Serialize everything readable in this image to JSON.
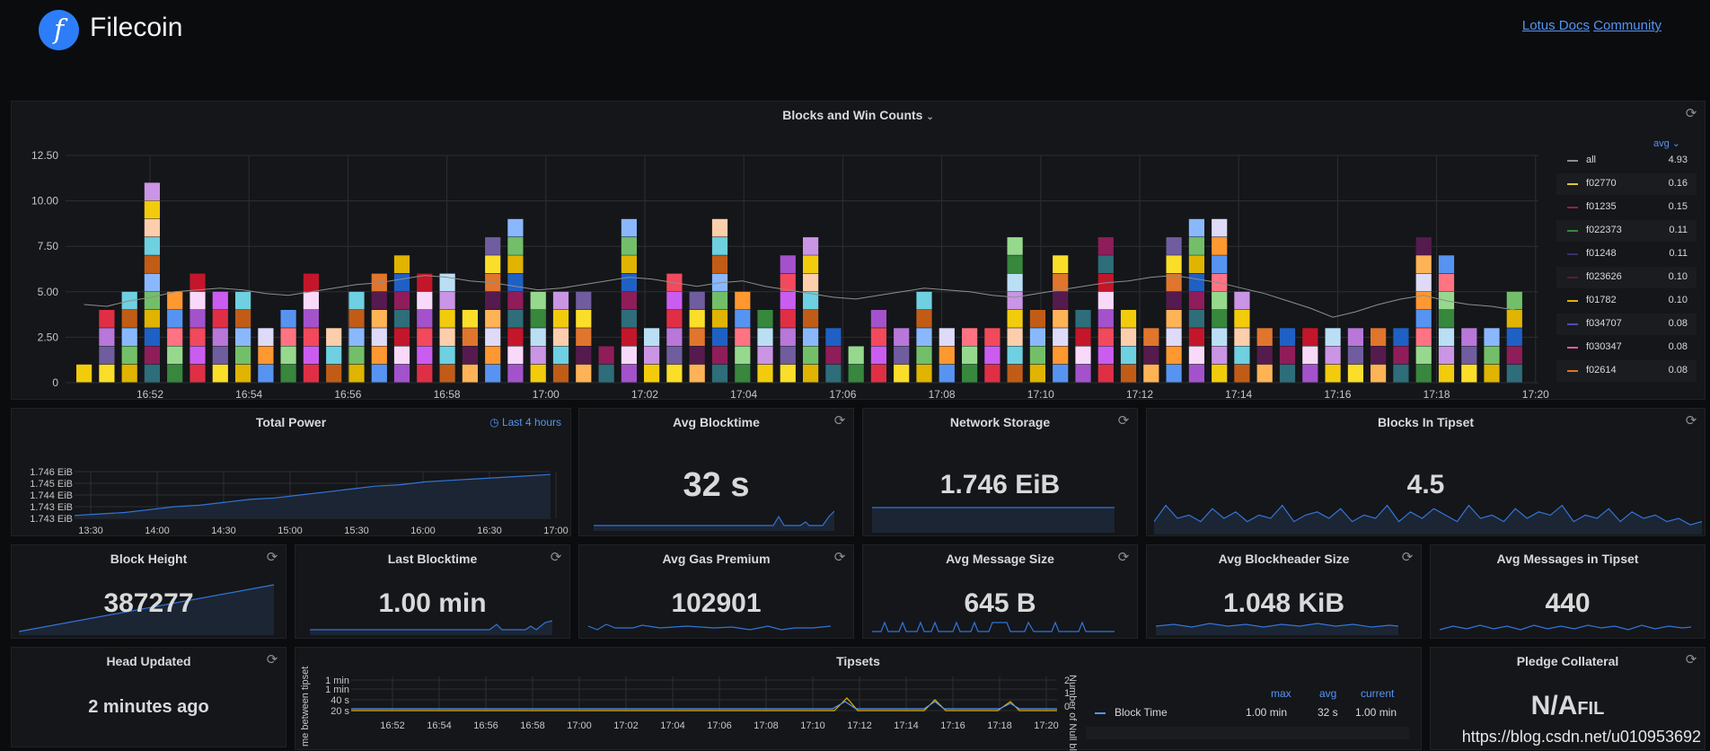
{
  "header": {
    "brand": "Filecoin",
    "logo_glyph": "f",
    "link_docs": "Lotus Docs",
    "link_community": "Community"
  },
  "blocks_panel": {
    "title": "Blocks and Win Counts",
    "legend_header": "avg",
    "legend": [
      {
        "name": "all",
        "value": "4.93",
        "color": "#8e8e8e"
      },
      {
        "name": "f02770",
        "value": "0.16",
        "color": "#e0c43a"
      },
      {
        "name": "f01235",
        "value": "0.15",
        "color": "#8f1d5a"
      },
      {
        "name": "f022373",
        "value": "0.11",
        "color": "#37873d"
      },
      {
        "name": "f01248",
        "value": "0.11",
        "color": "#3d2a6e"
      },
      {
        "name": "f023626",
        "value": "0.10",
        "color": "#5c1b36"
      },
      {
        "name": "f01782",
        "value": "0.10",
        "color": "#e0b400"
      },
      {
        "name": "f034707",
        "value": "0.08",
        "color": "#4d4db8"
      },
      {
        "name": "f030347",
        "value": "0.08",
        "color": "#e05ba8"
      },
      {
        "name": "f02614",
        "value": "0.08",
        "color": "#e0752d"
      }
    ],
    "y_ticks": [
      "12.50",
      "10.00",
      "7.50",
      "5.00",
      "2.50",
      "0"
    ],
    "x_ticks": [
      "16:52",
      "16:54",
      "16:56",
      "16:58",
      "17:00",
      "17:02",
      "17:04",
      "17:06",
      "17:08",
      "17:10",
      "17:12",
      "17:14",
      "17:16",
      "17:18",
      "17:20"
    ]
  },
  "chart_data": {
    "type": "bar",
    "title": "Blocks and Win Counts",
    "ylim": [
      0,
      12.5
    ],
    "palette": [
      "#f2cc0c",
      "#e0752d",
      "#8f1d5a",
      "#37873d",
      "#b877d9",
      "#73bf69",
      "#5794f2",
      "#f2495c",
      "#6ed0e0",
      "#ffb357",
      "#c4162a",
      "#ca95e5",
      "#fade2a",
      "#1f60c4",
      "#96d98d",
      "#e02f44",
      "#8ab8ff",
      "#ff9830",
      "#a352cc",
      "#fcceab",
      "#561b4e",
      "#2e6d7a",
      "#badff4",
      "#705da0",
      "#e0b400",
      "#ff7383",
      "#ca5def",
      "#c15c17",
      "#dedaf7",
      "#f9d9f9"
    ],
    "counts": [
      1,
      4,
      5,
      11,
      5,
      6,
      5,
      5,
      3,
      4,
      6,
      3,
      5,
      6,
      7,
      6,
      6,
      4,
      8,
      9,
      5,
      5,
      5,
      2,
      9,
      3,
      6,
      5,
      9,
      5,
      4,
      7,
      8,
      3,
      2,
      4,
      3,
      5,
      3,
      3,
      3,
      8,
      4,
      7,
      4,
      8,
      4,
      3,
      8,
      9,
      9,
      5,
      3,
      3,
      3,
      3,
      3,
      3,
      3,
      8,
      7,
      3,
      3,
      5
    ],
    "x_ticks": [
      "16:52",
      "16:54",
      "16:56",
      "16:58",
      "17:00",
      "17:02",
      "17:04",
      "17:06",
      "17:08",
      "17:10",
      "17:12",
      "17:14",
      "17:16",
      "17:18",
      "17:20"
    ],
    "avg_line": [
      4.3,
      4.2,
      4.5,
      4.7,
      5.0,
      5.1,
      5.2,
      5.1,
      4.9,
      4.8,
      5.0,
      5.2,
      5.4,
      5.5,
      5.7,
      5.9,
      5.8,
      5.6,
      5.5,
      5.3,
      5.1,
      5.2,
      5.4,
      5.6,
      5.8,
      5.7,
      5.5,
      5.3,
      5.5,
      5.6,
      5.3,
      5.1,
      4.9,
      4.7,
      4.6,
      4.8,
      5.0,
      5.2,
      5.1,
      5.0,
      4.8,
      4.7,
      4.9,
      5.1,
      5.3,
      5.5,
      5.6,
      5.8,
      5.9,
      5.7,
      5.5,
      5.2,
      4.9,
      4.5,
      4.1,
      3.6,
      3.9,
      4.3,
      4.6,
      4.8,
      4.5,
      4.3,
      4.2,
      4.0
    ],
    "legend": [
      {
        "name": "all",
        "avg": 4.93
      },
      {
        "name": "f02770",
        "avg": 0.16
      },
      {
        "name": "f01235",
        "avg": 0.15
      },
      {
        "name": "f022373",
        "avg": 0.11
      },
      {
        "name": "f01248",
        "avg": 0.11
      },
      {
        "name": "f023626",
        "avg": 0.1
      },
      {
        "name": "f01782",
        "avg": 0.1
      },
      {
        "name": "f034707",
        "avg": 0.08
      },
      {
        "name": "f030347",
        "avg": 0.08
      },
      {
        "name": "f02614",
        "avg": 0.08
      }
    ]
  },
  "total_power": {
    "title": "Total Power",
    "range_label": "Last 4 hours",
    "y_ticks": [
      "1.746 EiB",
      "1.745 EiB",
      "1.744 EiB",
      "1.743 EiB",
      "1.743 EiB"
    ],
    "x_ticks": [
      "13:30",
      "14:00",
      "14:30",
      "15:00",
      "15:30",
      "16:00",
      "16:30",
      "17:00"
    ],
    "series": [
      1.7432,
      1.7433,
      1.7434,
      1.7436,
      1.7438,
      1.7439,
      1.7441,
      1.7443,
      1.7444,
      1.7446,
      1.7448,
      1.745,
      1.7452,
      1.7453,
      1.7455,
      1.7456,
      1.7457,
      1.7458,
      1.7459,
      1.746
    ]
  },
  "stats": {
    "avg_blocktime": {
      "title": "Avg Blocktime",
      "value": "32 s"
    },
    "network_storage": {
      "title": "Network Storage",
      "value": "1.746 EiB"
    },
    "blocks_in_tipset": {
      "title": "Blocks In Tipset",
      "value": "4.5"
    },
    "block_height": {
      "title": "Block Height",
      "value": "387277"
    },
    "last_blocktime": {
      "title": "Last Blocktime",
      "value": "1.00 min"
    },
    "avg_gas_premium": {
      "title": "Avg Gas Premium",
      "value": "102901"
    },
    "avg_message_size": {
      "title": "Avg Message Size",
      "value": "645 B"
    },
    "avg_blockheader_size": {
      "title": "Avg Blockheader Size",
      "value": "1.048 KiB"
    },
    "avg_messages_tipset": {
      "title": "Avg Messages in Tipset",
      "value": "440"
    },
    "head_updated": {
      "title": "Head Updated",
      "value": "2 minutes ago"
    },
    "pledge": {
      "title": "Pledge Collateral",
      "value": "N/A",
      "unit": "FIL"
    }
  },
  "tipsets": {
    "title": "Tipsets",
    "y_label_left": "me between tipsets",
    "y_label_right": "Number of Null bloc",
    "y_ticks_left": [
      "1 min",
      "1 min",
      "40 s",
      "20 s"
    ],
    "y_ticks_right": [
      "2",
      "1",
      "0"
    ],
    "x_ticks": [
      "16:52",
      "16:54",
      "16:56",
      "16:58",
      "17:00",
      "17:02",
      "17:04",
      "17:06",
      "17:08",
      "17:10",
      "17:12",
      "17:14",
      "17:16",
      "17:18",
      "17:20"
    ],
    "table_headers": {
      "max": "max",
      "avg": "avg",
      "current": "current"
    },
    "row": {
      "name": "Block Time",
      "max": "1.00 min",
      "avg": "32 s",
      "current": "1.00 min"
    }
  },
  "watermark": "https://blog.csdn.net/u010953692"
}
